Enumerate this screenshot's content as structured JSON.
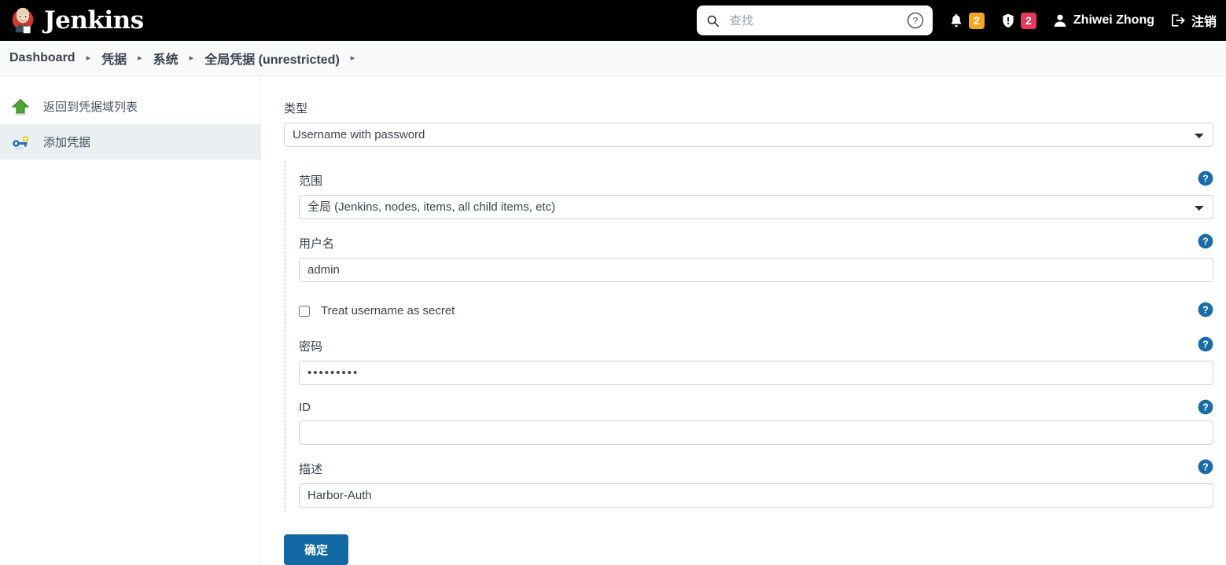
{
  "header": {
    "brand": "Jenkins",
    "brand_logo_icon": "jenkins-butler-logo",
    "search": {
      "placeholder": "查找",
      "value": "",
      "search_icon": "search-icon",
      "help_icon": "question-circle-icon"
    },
    "notifications": {
      "icon": "bell-icon",
      "count": "2",
      "color": "#f5a623"
    },
    "security": {
      "icon": "shield-exclamation-icon",
      "count": "2",
      "color": "#e5395e"
    },
    "user": {
      "icon": "person-icon",
      "name": "Zhiwei Zhong"
    },
    "logout": {
      "icon": "logout-icon",
      "label": "注销"
    }
  },
  "breadcrumb": {
    "separator": "▸",
    "items": [
      {
        "label": "Dashboard"
      },
      {
        "label": "凭据"
      },
      {
        "label": "系统"
      },
      {
        "label": "全局凭据 (unrestricted)"
      }
    ]
  },
  "sidebar": {
    "items": [
      {
        "label": "返回到凭据域列表",
        "icon": "up-arrow-icon",
        "selected": false
      },
      {
        "label": "添加凭据",
        "icon": "key-add-icon",
        "selected": true
      }
    ]
  },
  "form": {
    "type": {
      "label": "类型",
      "value": "Username with password",
      "options": [
        "Username with password"
      ]
    },
    "scope": {
      "label": "范围",
      "value": "全局 (Jenkins, nodes, items, all child items, etc)",
      "options": [
        "全局 (Jenkins, nodes, items, all child items, etc)"
      ],
      "help_icon": "help-icon"
    },
    "username": {
      "label": "用户名",
      "value": "admin",
      "help_icon": "help-icon"
    },
    "treat_secret": {
      "label": "Treat username as secret",
      "checked": false,
      "help_icon": "help-icon"
    },
    "password": {
      "label": "密码",
      "value": "•••••••••",
      "help_icon": "help-icon"
    },
    "id": {
      "label": "ID",
      "value": "",
      "help_icon": "help-icon"
    },
    "description": {
      "label": "描述",
      "value": "Harbor-Auth",
      "help_icon": "help-icon"
    },
    "submit": {
      "label": "确定",
      "color": "#1268a3"
    }
  }
}
